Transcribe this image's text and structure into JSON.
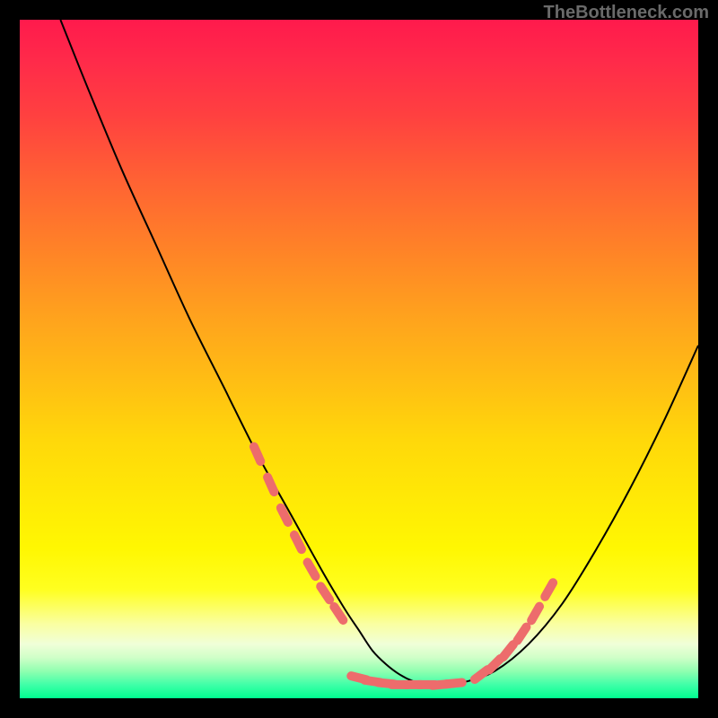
{
  "watermark": "TheBottleneck.com",
  "chart_data": {
    "type": "line",
    "title": "",
    "xlabel": "",
    "ylabel": "",
    "xlim": [
      0,
      100
    ],
    "ylim": [
      0,
      100
    ],
    "series": [
      {
        "name": "curve",
        "color": "#000000",
        "x": [
          6,
          10,
          15,
          20,
          25,
          30,
          35,
          40,
          45,
          48,
          50,
          52,
          54,
          56,
          58,
          60,
          63,
          66,
          70,
          75,
          80,
          85,
          90,
          95,
          100
        ],
        "y": [
          100,
          90,
          78,
          67,
          56,
          46,
          36,
          27,
          18,
          13,
          10,
          7,
          5,
          3.5,
          2.5,
          2,
          2,
          2.5,
          4,
          8,
          14,
          22,
          31,
          41,
          52
        ]
      }
    ],
    "highlights": [
      {
        "name": "dotted-overlay",
        "color": "#ed6c6c",
        "segments": [
          {
            "x": [
              35,
              37,
              39,
              41,
              43,
              45,
              47
            ],
            "y": [
              36,
              31.5,
              27,
              23,
              19,
              15.5,
              12.5
            ]
          },
          {
            "x": [
              50,
              52,
              54,
              56,
              58,
              60,
              62,
              64
            ],
            "y": [
              3,
              2.5,
              2.2,
              2.0,
              2.0,
              2.0,
              2.0,
              2.2
            ]
          },
          {
            "x": [
              68,
              70,
              72,
              74,
              76,
              78
            ],
            "y": [
              3.5,
              5,
              7,
              9.5,
              12.5,
              16
            ]
          }
        ]
      }
    ]
  }
}
